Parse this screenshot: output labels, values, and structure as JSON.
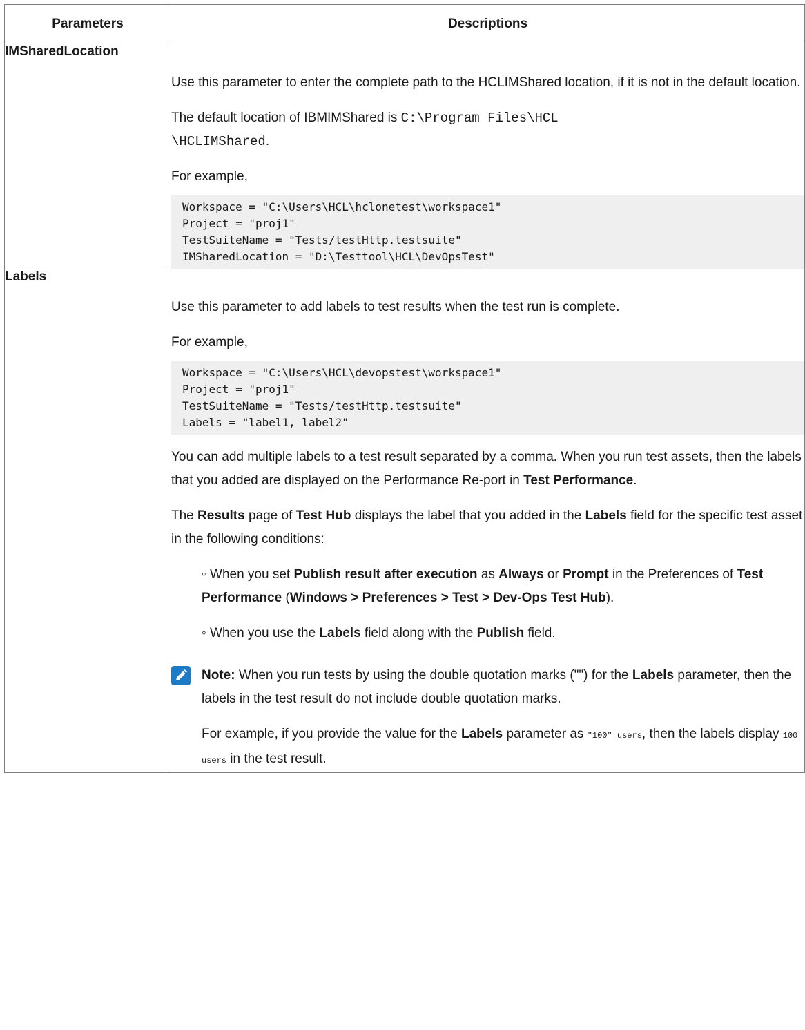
{
  "table": {
    "header": {
      "col1": "Parameters",
      "col2": "Descriptions"
    },
    "row1": {
      "name": "IMSharedLocation",
      "p1": "Use this parameter to enter the complete path to the HCLIMShared location, if it is not in the default location.",
      "p2_pre": "The default location of IBMIMShared is ",
      "p2_code_a": "C:\\Program Files\\HCL",
      "p2_code_b": "\\HCLIMShared",
      "p2_post": ".",
      "p3": "For example,",
      "code": "Workspace = \"C:\\Users\\HCL\\hclonetest\\workspace1\"\nProject = \"proj1\"\nTestSuiteName = \"Tests/testHttp.testsuite\"\nIMSharedLocation = \"D:\\Testtool\\HCL\\DevOpsTest\""
    },
    "row2": {
      "name": "Labels",
      "p1": "Use this parameter to add labels to test results when the test run is complete.",
      "p2": "For example,",
      "code": "Workspace = \"C:\\Users\\HCL\\devopstest\\workspace1\"\nProject = \"proj1\"\nTestSuiteName = \"Tests/testHttp.testsuite\"\nLabels = \"label1, label2\"",
      "p3_text": "You can add multiple labels to a test result separated by a comma. When you run test assets, then the labels that you added are displayed on the Performance Re-port in ",
      "p3_bold": "Test Performance",
      "p3_end": ".",
      "p4": {
        "t1": "The ",
        "b1": "Results",
        "t2": " page of ",
        "b2": "Test Hub",
        "t3": " displays the label that you added in the ",
        "b3": "Labels",
        "t4": " field for the specific test asset in the following conditions:"
      },
      "cond1": {
        "t1": "When you set ",
        "b1": "Publish result after execution",
        "t2": " as ",
        "b2": "Always",
        "t3": " or ",
        "b3": "Prompt",
        "t4": " in the Preferences of ",
        "b4": "Test Performance",
        "t5": " (",
        "b5": "Windows > Preferences > Test > Dev-Ops Test Hub",
        "t6": ")."
      },
      "cond2": {
        "t1": "When you use the ",
        "b1": "Labels",
        "t2": " field along with the ",
        "b2": "Publish",
        "t3": " field."
      },
      "note": {
        "label": "Note:",
        "t1": " When you run tests by using the double quotation marks (\"\") for the ",
        "b1": "Labels",
        "t2": " parameter, then the labels in the test result do not include double quotation marks.",
        "ex_t1": "For example, if you provide the value for the ",
        "ex_b1": "Labels",
        "ex_t2": " parameter as ",
        "ex_c1": "\"100\" users",
        "ex_t3": ", then the labels display ",
        "ex_c2": "100 users",
        "ex_t4": " in the test result."
      }
    }
  },
  "icons": {
    "note": "pencil-icon"
  },
  "colors": {
    "note_icon_bg": "#1d7bc5",
    "code_bg": "#efefef"
  }
}
